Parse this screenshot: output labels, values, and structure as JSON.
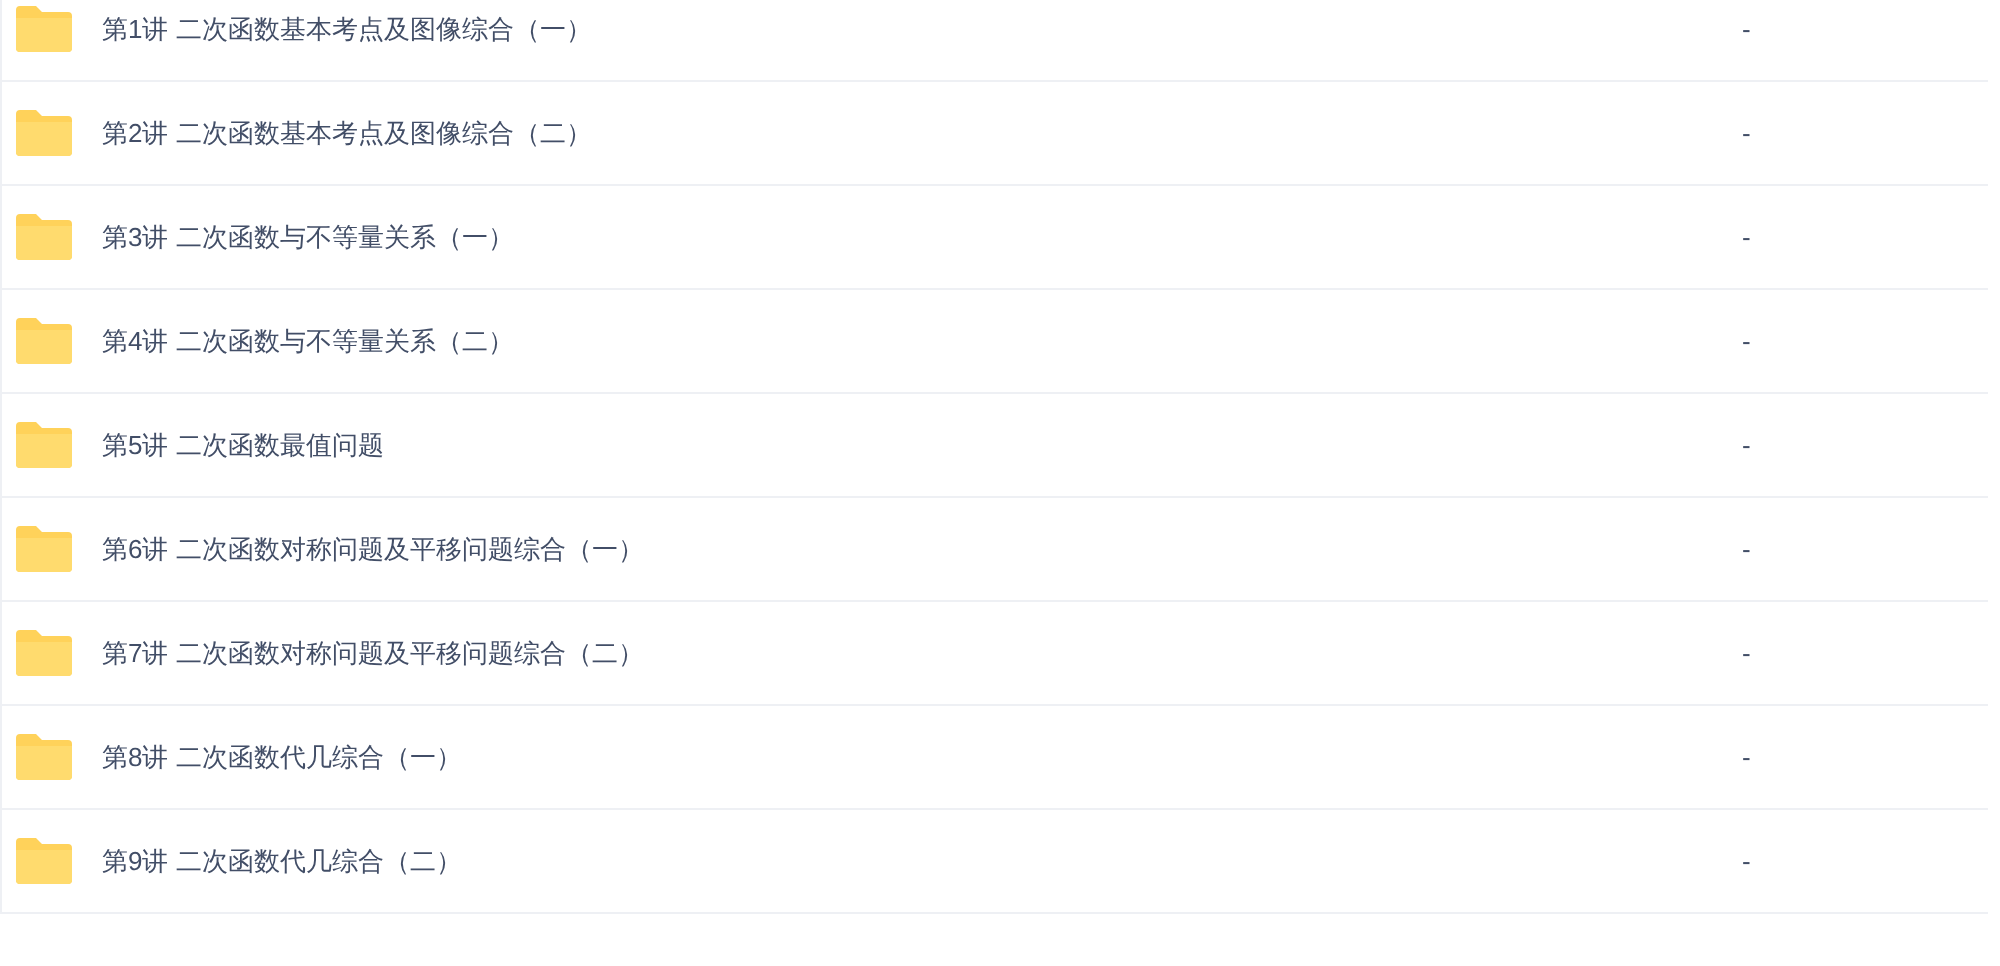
{
  "files": [
    {
      "name": "第1讲 二次函数基本考点及图像综合（一）",
      "size": "-"
    },
    {
      "name": "第2讲 二次函数基本考点及图像综合（二）",
      "size": "-"
    },
    {
      "name": "第3讲 二次函数与不等量关系（一）",
      "size": "-"
    },
    {
      "name": "第4讲 二次函数与不等量关系（二）",
      "size": "-"
    },
    {
      "name": "第5讲 二次函数最值问题",
      "size": "-"
    },
    {
      "name": "第6讲 二次函数对称问题及平移问题综合（一）",
      "size": "-"
    },
    {
      "name": "第7讲 二次函数对称问题及平移问题综合（二）",
      "size": "-"
    },
    {
      "name": "第8讲 二次函数代几综合（一）",
      "size": "-"
    },
    {
      "name": "第9讲 二次函数代几综合（二）",
      "size": "-"
    }
  ]
}
